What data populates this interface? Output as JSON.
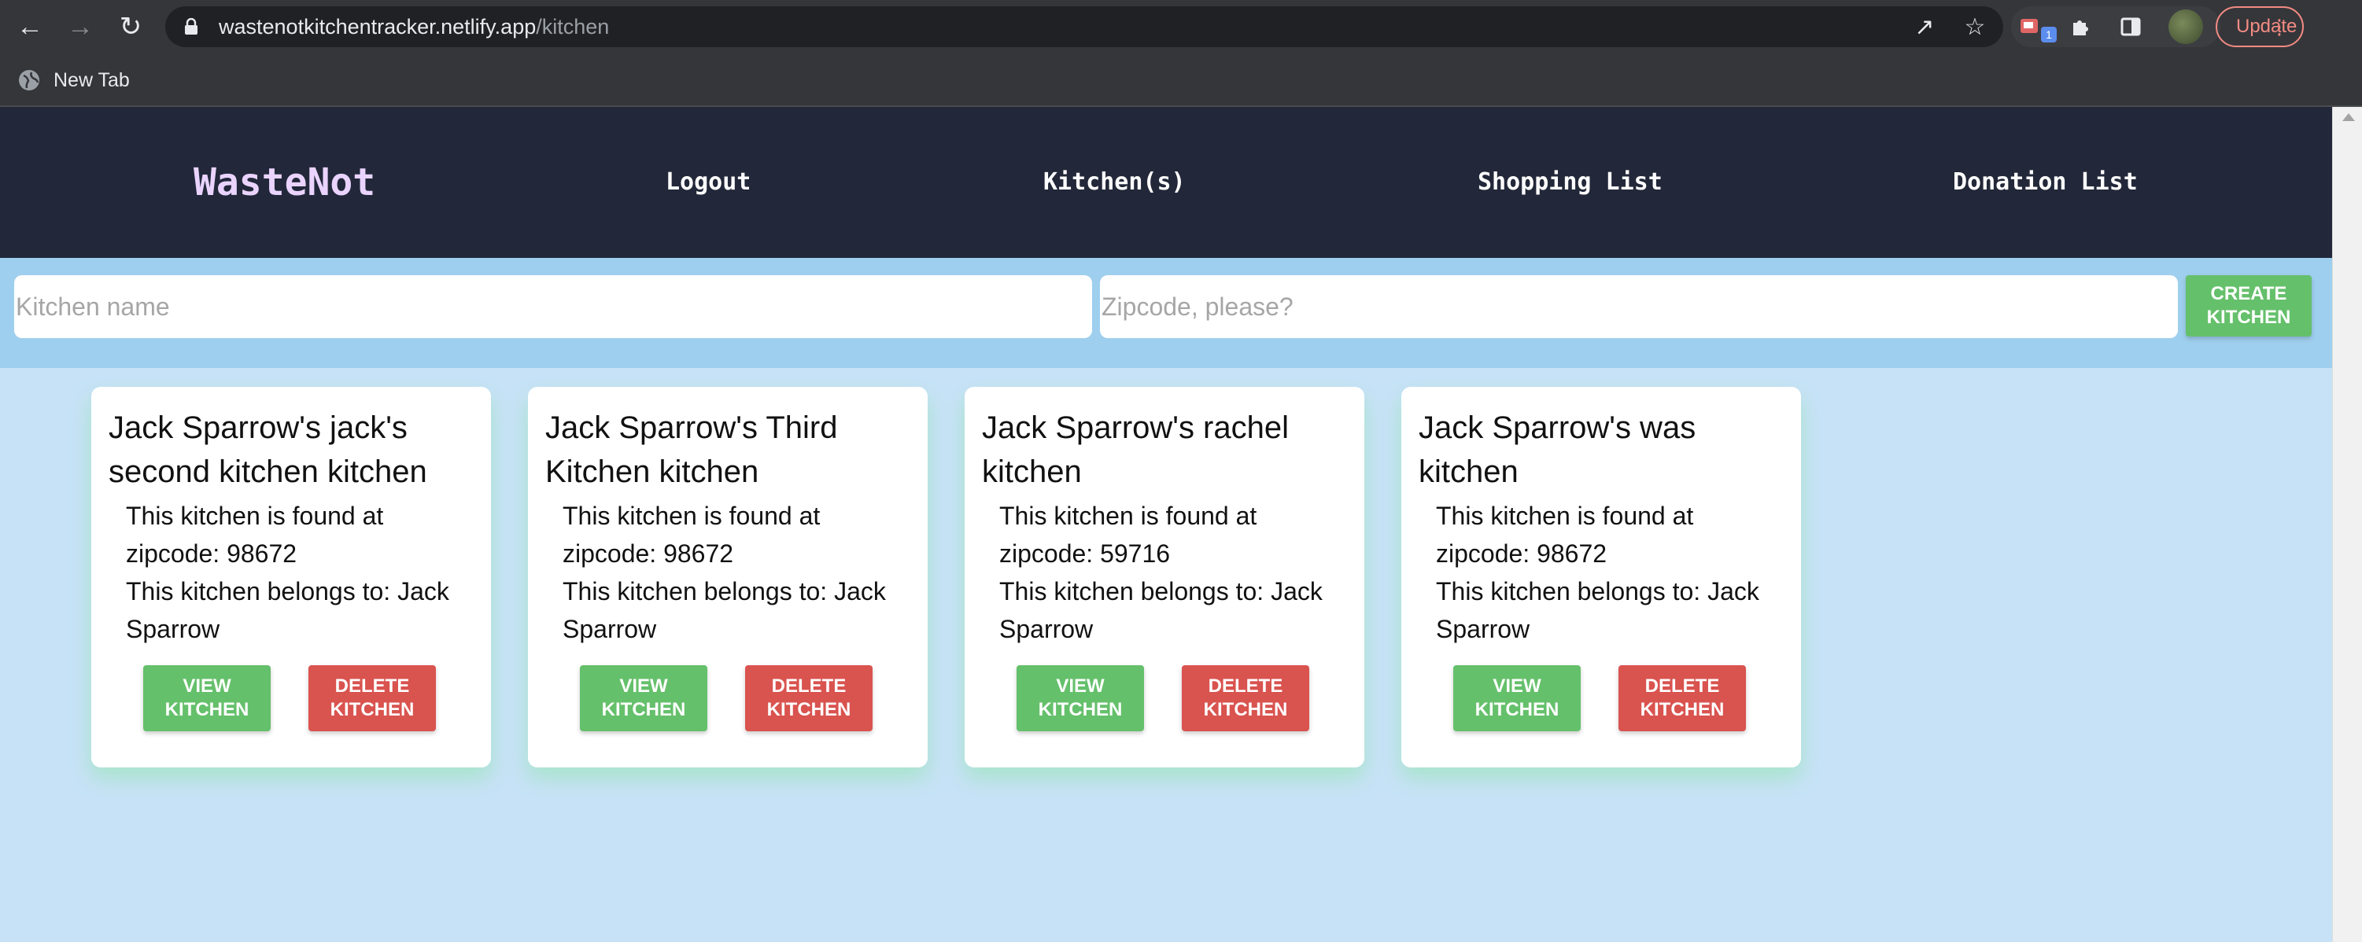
{
  "browser": {
    "url_host": "wastenotkitchentracker.netlify.app",
    "url_path": "/kitchen",
    "update_label": "Update",
    "extension_badge": "1",
    "bookmarks": [
      {
        "label": "New Tab",
        "icon": "globe-icon"
      }
    ]
  },
  "navbar": {
    "brand": "WasteNot",
    "links": [
      "Logout",
      "Kitchen(s)",
      "Shopping List",
      "Donation List"
    ]
  },
  "form": {
    "name_placeholder": "Kitchen name",
    "zip_placeholder": "Zipcode, please?",
    "create_label": "CREATE KITCHEN"
  },
  "kitchens": [
    {
      "title": "Jack Sparrow's jack's second kitchen kitchen",
      "zip_text": "This kitchen is found at zipcode: 98672",
      "owner_text": "This kitchen belongs to: Jack Sparrow",
      "view_label": "VIEW KITCHEN",
      "delete_label": "DELETE KITCHEN"
    },
    {
      "title": "Jack Sparrow's Third Kitchen kitchen",
      "zip_text": "This kitchen is found at zipcode: 98672",
      "owner_text": "This kitchen belongs to: Jack Sparrow",
      "view_label": "VIEW KITCHEN",
      "delete_label": "DELETE KITCHEN"
    },
    {
      "title": "Jack Sparrow's rachel kitchen",
      "zip_text": "This kitchen is found at zipcode: 59716",
      "owner_text": "This kitchen belongs to: Jack Sparrow",
      "view_label": "VIEW KITCHEN",
      "delete_label": "DELETE KITCHEN"
    },
    {
      "title": "Jack Sparrow's was kitchen",
      "zip_text": "This kitchen is found at zipcode: 98672",
      "owner_text": "This kitchen belongs to: Jack Sparrow",
      "view_label": "VIEW KITCHEN",
      "delete_label": "DELETE KITCHEN"
    }
  ],
  "colors": {
    "navbar": "#222839",
    "brand": "#ead4ff",
    "page_bg": "#c7e2f7",
    "form_strip": "#9fcfee",
    "view_button": "#65c06b",
    "delete_button": "#d9534f"
  }
}
